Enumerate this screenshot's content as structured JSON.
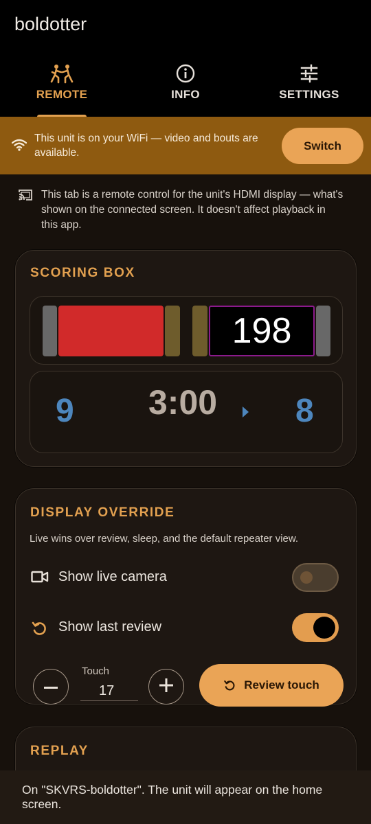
{
  "app": {
    "title": "boldotter"
  },
  "tabs": [
    {
      "label": "REMOTE",
      "icon": "fencers-icon",
      "active": true
    },
    {
      "label": "INFO",
      "icon": "info-icon",
      "active": false
    },
    {
      "label": "SETTINGS",
      "icon": "sliders-icon",
      "active": false
    }
  ],
  "wifi_banner": {
    "icon": "wifi-icon",
    "text": "This unit is on your WiFi — video and bouts are available.",
    "button_label": "Switch"
  },
  "hdmi_note": {
    "icon": "cast-icon",
    "text": "This tab is a remote control for the unit's HDMI display — what's shown on the connected screen. It doesn't affect playback in this app."
  },
  "scoring_box": {
    "title": "SCORING BOX",
    "lights": {
      "left_color": "#d12a2a",
      "right_number": "198",
      "right_border_color": "#8c1a8c"
    },
    "score_left": "9",
    "clock": "3:00",
    "score_right": "8",
    "priority": "right"
  },
  "display_override": {
    "title": "DISPLAY OVERRIDE",
    "description": "Live wins over review, sleep, and the default repeater view.",
    "show_live_camera": {
      "label": "Show live camera",
      "icon": "video-camera-icon",
      "on": false
    },
    "show_last_review": {
      "label": "Show last review",
      "icon": "replay-icon",
      "on": true
    },
    "touch": {
      "label": "Touch",
      "value": "17"
    },
    "review_button_label": "Review touch"
  },
  "replay": {
    "title": "REPLAY"
  },
  "snackbar": {
    "text": "On \"SKVRS-boldotter\". The unit will appear on the home screen."
  },
  "colors": {
    "accent": "#e3a150",
    "banner": "#8e5a10",
    "score_blue": "#4d86bd"
  }
}
